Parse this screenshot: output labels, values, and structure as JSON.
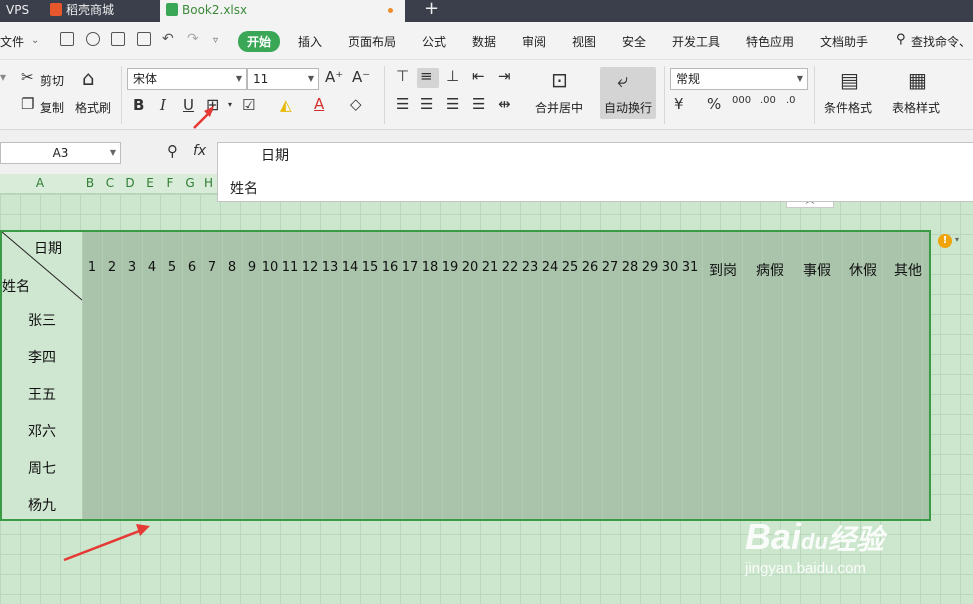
{
  "tabs": [
    {
      "label": "VPS"
    },
    {
      "label": "稻壳商城"
    },
    {
      "label": "Book2.xlsx"
    }
  ],
  "new_tab_icon": "+",
  "menu": {
    "file": "文件",
    "items": [
      "开始",
      "插入",
      "页面布局",
      "公式",
      "数据",
      "审阅",
      "视图",
      "安全",
      "开发工具",
      "特色应用",
      "文档助手"
    ],
    "search": "查找命令、"
  },
  "toolbar": {
    "cut": "剪切",
    "copy": "复制",
    "format_painter": "格式刷",
    "font_name": "宋体",
    "font_size": "11",
    "bold": "B",
    "italic": "I",
    "underline": "U",
    "merge_center": "合并居中",
    "wrap_text": "自动换行",
    "number_format": "常规",
    "percent": "%",
    "conditional_format": "条件格式",
    "table_style": "表格样式"
  },
  "formula_bar": {
    "cell_ref": "A3",
    "fx": "fx",
    "content_line1": "日期",
    "content_line2": "姓名"
  },
  "columns": [
    "A",
    "B",
    "C",
    "D",
    "E",
    "F",
    "G",
    "H"
  ],
  "sheet": {
    "diag_top": "日期",
    "diag_bottom": "姓名",
    "days": [
      "1",
      "2",
      "3",
      "4",
      "5",
      "6",
      "7",
      "8",
      "9",
      "10",
      "11",
      "12",
      "13",
      "14",
      "15",
      "16",
      "17",
      "18",
      "19",
      "20",
      "21",
      "22",
      "23",
      "24",
      "25",
      "26",
      "27",
      "28",
      "29",
      "30",
      "31"
    ],
    "summary_headers": [
      "到岗",
      "病假",
      "事假",
      "休假",
      "其他"
    ],
    "names": [
      "张三",
      "李四",
      "王五",
      "邓六",
      "周七",
      "杨九"
    ]
  },
  "watermark": {
    "brand": "Bai",
    "brand2": "经验",
    "url": "jingyan.baidu.com"
  },
  "colors": {
    "accent": "#3aa757",
    "selection_border": "#3b9a45",
    "arrow": "#e53935"
  }
}
